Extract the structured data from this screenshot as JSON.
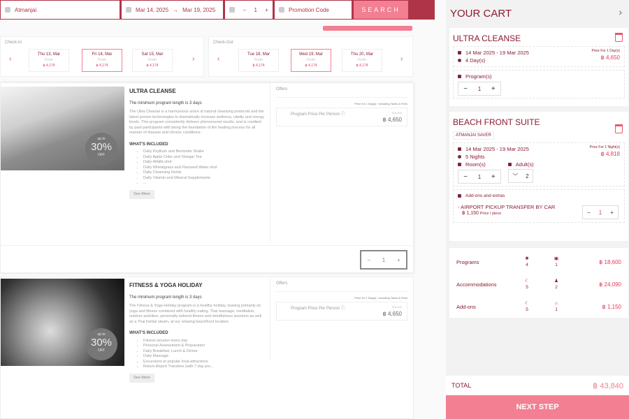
{
  "search": {
    "location": "Atmanjai",
    "date_from": "Mar 14, 2025",
    "date_arrow": "→",
    "date_to": "Mar 19, 2025",
    "guests": "1",
    "minus": "−",
    "plus": "+",
    "promo_placeholder": "Promotion Code",
    "search_label": "SEARCH"
  },
  "check_in": {
    "label": "Check-In",
    "days": [
      {
        "day": "Thu 13, Mar",
        "from": "From",
        "price": "฿ 4,174"
      },
      {
        "day": "Fri 14, Mar",
        "from": "From",
        "price": "฿ 4,174",
        "selected": true
      },
      {
        "day": "Sat 15, Mar",
        "from": "From",
        "price": "฿ 4,174"
      }
    ]
  },
  "check_out": {
    "label": "Check-Out",
    "days": [
      {
        "day": "Tue 18, Mar",
        "from": "From",
        "price": "฿ 4,174"
      },
      {
        "day": "Wed 19, Mar",
        "from": "From",
        "price": "฿ 4,174",
        "selected": true
      },
      {
        "day": "Thu 20, Mar",
        "from": "From",
        "price": "฿ 4,174"
      }
    ]
  },
  "programs": [
    {
      "title": "ULTRA CLEANSE",
      "badge_top": "up to",
      "badge_value": "30%",
      "badge_bottom": "OFF",
      "min_length": "The minimum program length is 3 days",
      "description": "The Ultra Cleanse is a harmonious union of natural cleansing protocols and the latest proven technologies to dramatically increase wellness, vitality and energy levels. This program consistently delivers phenomenal results, and is credited by past participants with being the foundation of the healing process for all manner of disease and chronic conditions.",
      "included_label": "WHAT'S INCLUDED",
      "included": [
        "Daily Psyllium and Bentonite Shake",
        "Daily Apple Cider and Vinegar Tea",
        "Daily Alfalfa shot",
        "Daily Wheatgrass and Flaxseed Water shot",
        "Daily Cleansing Herbs",
        "Daily Vitamin and Mineral Supplements",
        "..."
      ],
      "see_more": "See More",
      "offers_label": "Offers",
      "offer_note": "Price for 1 Day(s) / Including Taxes & Fees",
      "offer_name": "Program Price Per Person ⓘ",
      "offer_old": "฿ 6,643",
      "offer_price": "฿ 4,650",
      "qty": "1"
    },
    {
      "title": "FITNESS & YOGA HOLIDAY",
      "badge_top": "up to",
      "badge_value": "30%",
      "badge_bottom": "OFF",
      "min_length": "The minimum program length is 3 days",
      "description": "The Fitness & Yoga Holiday program is a healthy holiday, leaning primarily on yoga and fitness combined with healthy eating. Thai massage, meditation, outdoor activities, personally tailored fitness and mindfulness sessions as well as a Thai herbal steam, at our relaxing beachfront location.",
      "included_label": "WHAT'S INCLUDED",
      "included": [
        "Fitness session every day",
        "Personal Assessment & Preparation",
        "Daily Breakfast, Lunch & Dinner",
        "Daily Massage",
        "Excursions to popular local attractions",
        "Return Airport Transfers (with 7 day pro..."
      ],
      "see_more": "See More",
      "offers_label": "Offers",
      "offer_note": "Price for 1 Day(s) / Including Taxes & Fees",
      "offer_name": "Program Price Per Person ⓘ",
      "offer_old": "฿ 6,643",
      "offer_price": "฿ 4,650"
    }
  ],
  "cart": {
    "title": "YOUR CART",
    "items": [
      {
        "title": "ULTRA CLEANSE",
        "dates": "14 Mar 2025 - 19 Mar 2025",
        "duration": "4 Day(s)",
        "price_label": "Price For 1 Day(s)",
        "price": "฿ 4,650",
        "qty_label": "Program(s)",
        "qty": "1"
      },
      {
        "title": "BEACH FRONT SUITE",
        "tag": "ATMANJAI SAVER",
        "dates": "14 Mar 2025 - 19 Mar 2025",
        "duration": "5 Nights",
        "price_label": "Price For 1 Night(s)",
        "price": "฿ 4,818",
        "rooms_label": "Room(s)",
        "rooms": "1",
        "adults_label": "Adult(s)",
        "adults": "2",
        "addons_label": "Add-ons and extras",
        "addon_name": "- AIRPORT PICKUP TRANSFER BY CAR",
        "addon_price": "฿ 1,150",
        "addon_unit": "Price / piece",
        "addon_qty": "1"
      }
    ],
    "summary": [
      {
        "label": "Programs",
        "c1": "4",
        "c2": "1",
        "value": "฿ 18,600"
      },
      {
        "label": "Accommodations",
        "c1": "5",
        "c2": "2",
        "value": "฿ 24,090"
      },
      {
        "label": "Add-ons",
        "c1": "5",
        "c2": "1",
        "value": "฿ 1,150"
      }
    ],
    "total_label": "TOTAL",
    "total": "฿ 43,840",
    "next_label": "NEXT STEP"
  }
}
